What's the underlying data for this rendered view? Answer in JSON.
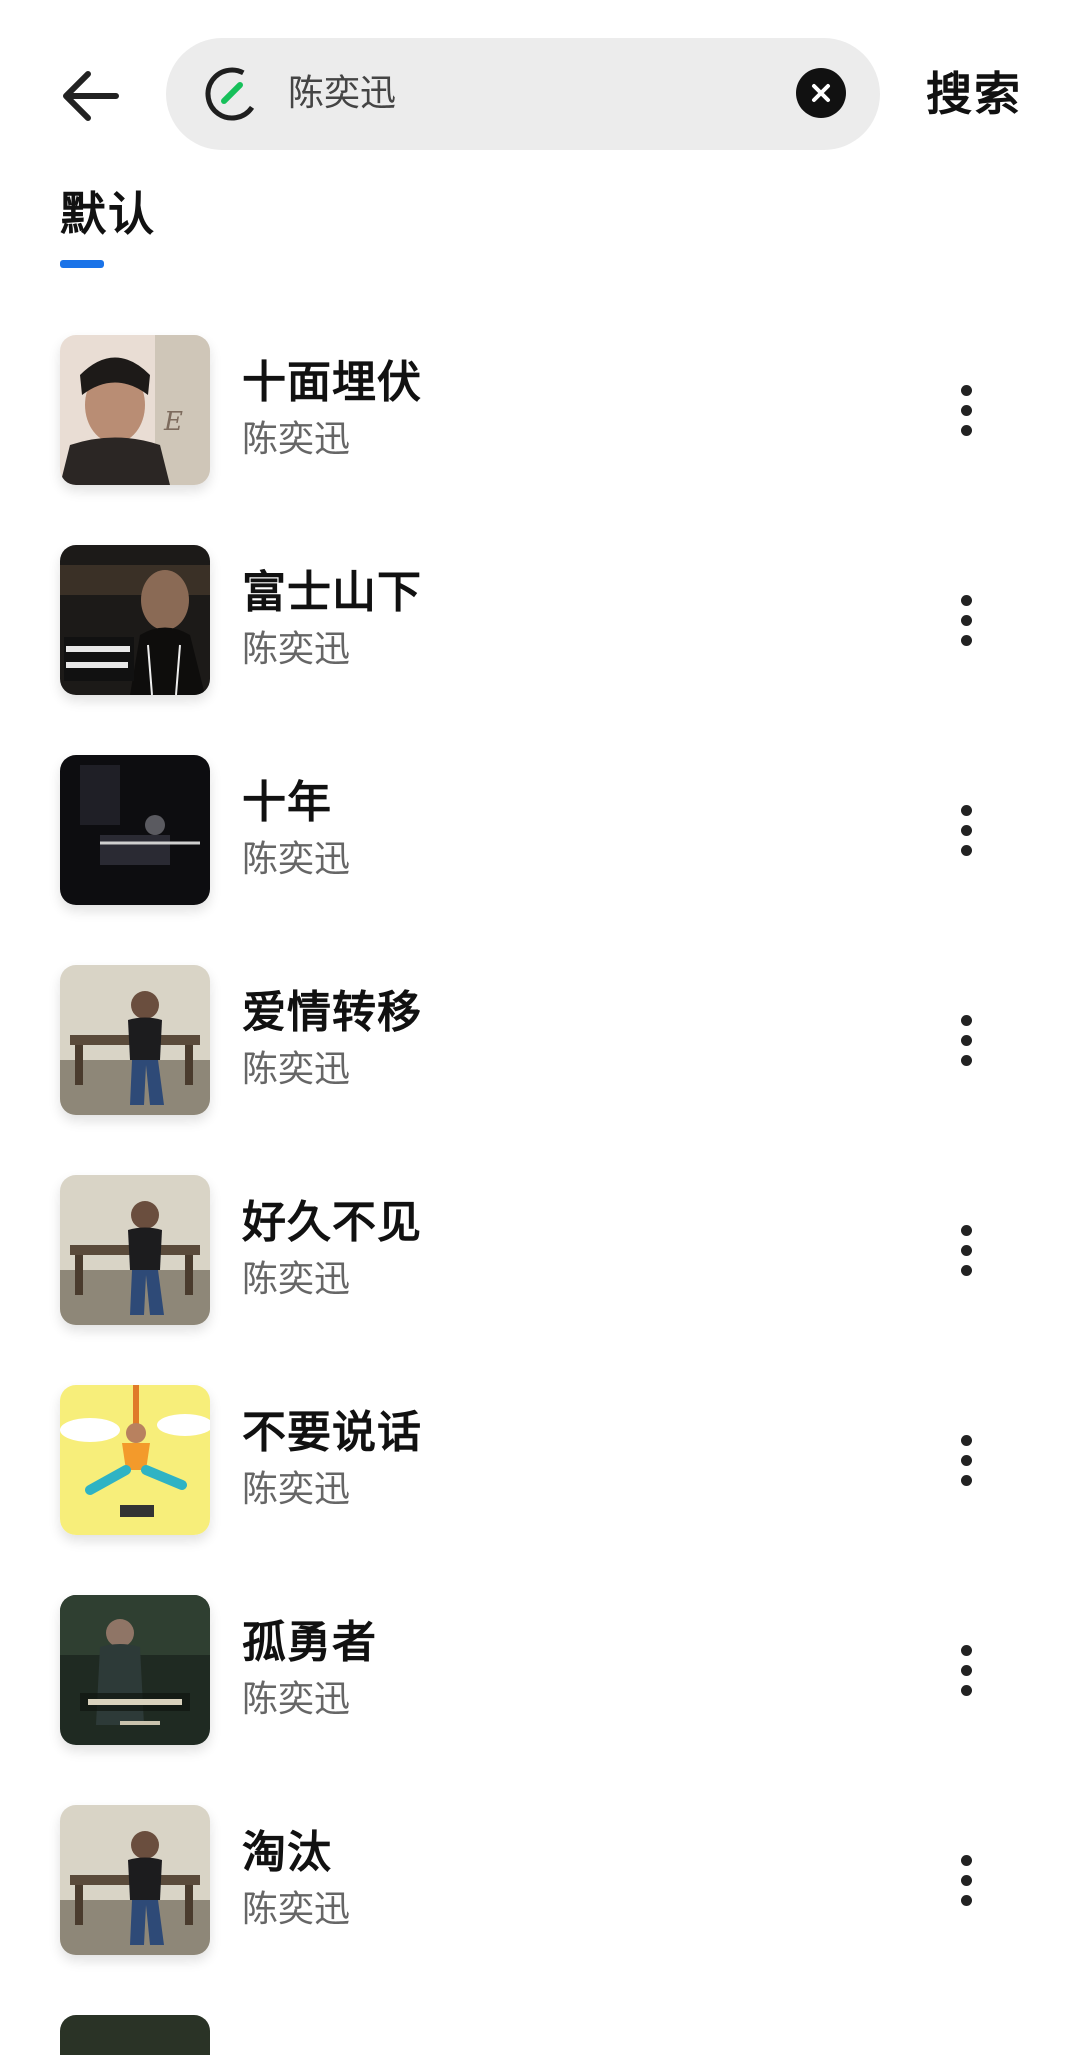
{
  "search": {
    "query": "陈奕迅",
    "submit_label": "搜索"
  },
  "tabs": [
    {
      "label": "默认",
      "active": true
    }
  ],
  "accent_color": "#1a73e8",
  "songs": [
    {
      "title": "十面埋伏",
      "artist": "陈奕迅"
    },
    {
      "title": "富士山下",
      "artist": "陈奕迅"
    },
    {
      "title": "十年",
      "artist": "陈奕迅"
    },
    {
      "title": "爱情转移",
      "artist": "陈奕迅"
    },
    {
      "title": "好久不见",
      "artist": "陈奕迅"
    },
    {
      "title": "不要说话",
      "artist": "陈奕迅"
    },
    {
      "title": "孤勇者",
      "artist": "陈奕迅"
    },
    {
      "title": "淘汰",
      "artist": "陈奕迅"
    }
  ],
  "icons": {
    "back": "arrow-left-icon",
    "logo": "music-app-logo-icon",
    "clear": "close-circle-icon",
    "more": "more-vertical-icon"
  }
}
